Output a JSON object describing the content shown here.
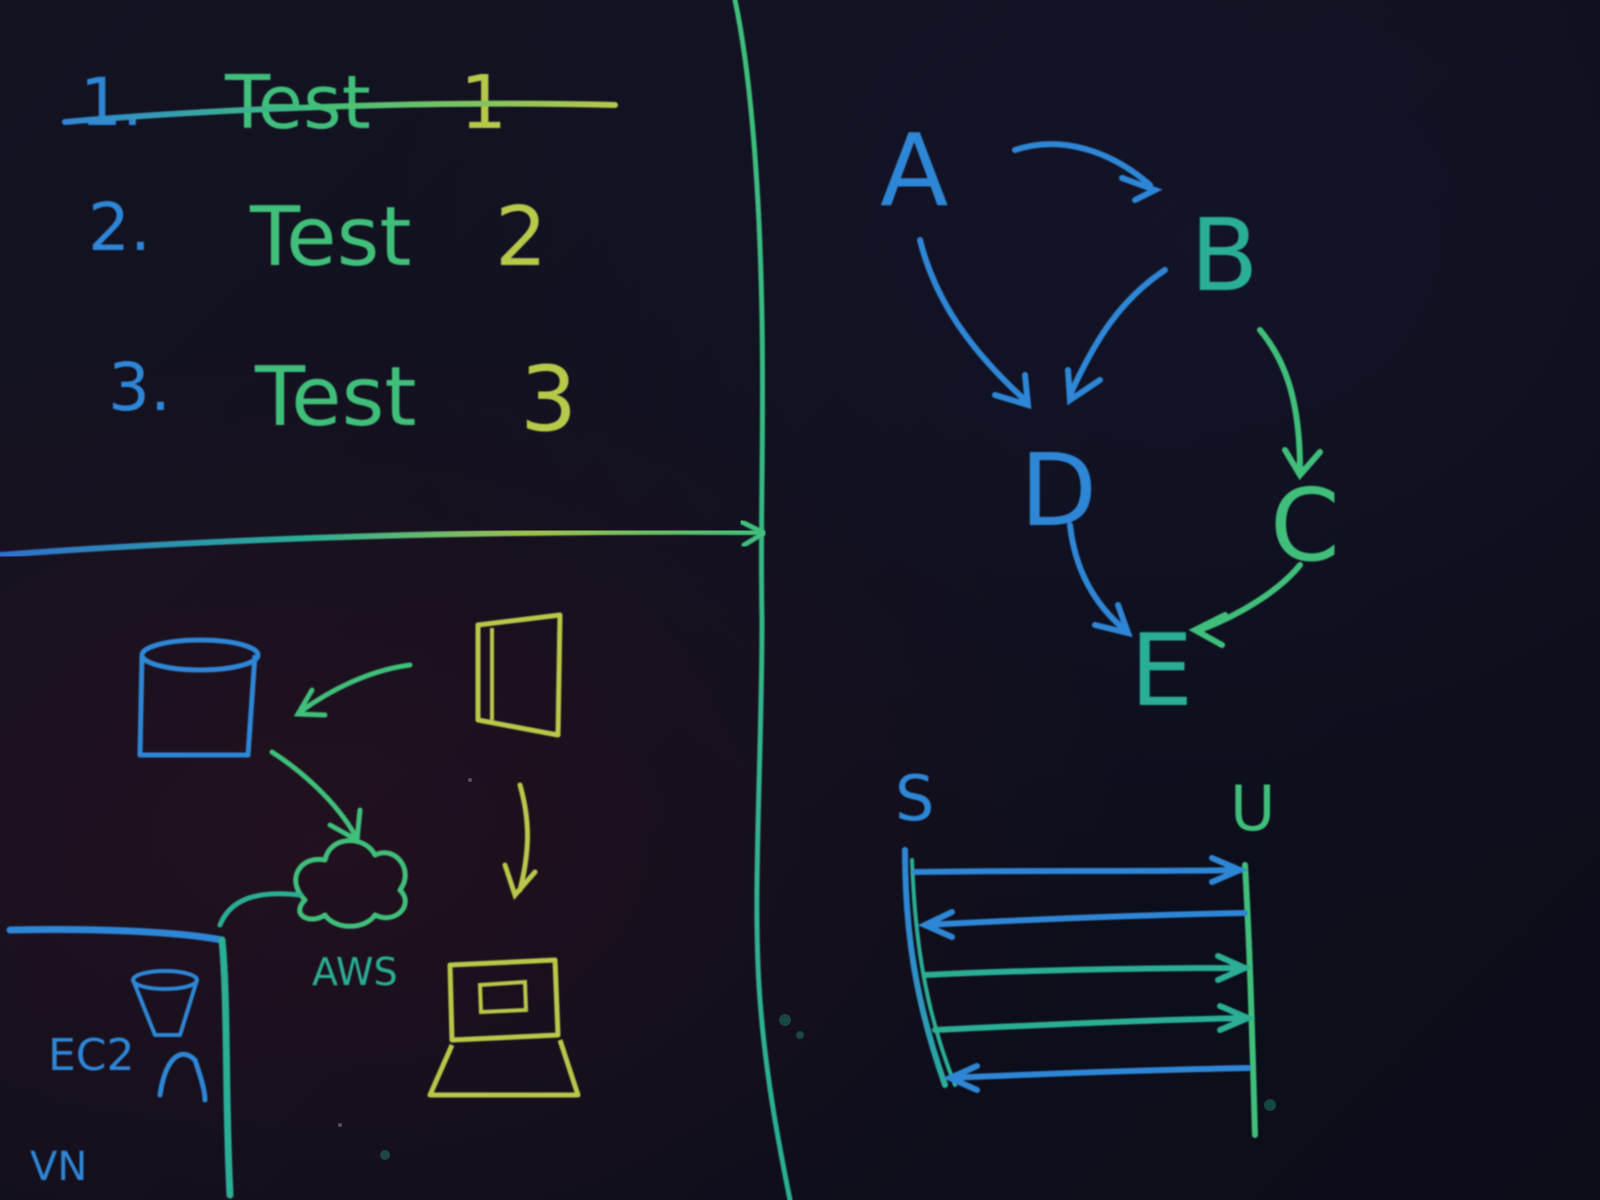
{
  "todo_list": {
    "items": [
      {
        "number": "1.",
        "text": "Test",
        "index": "1",
        "struck": true
      },
      {
        "number": "2.",
        "text": "Test",
        "index": "2",
        "struck": false
      },
      {
        "number": "3.",
        "text": "Test",
        "index": "3",
        "struck": false
      }
    ]
  },
  "graph": {
    "nodes": [
      "A",
      "B",
      "C",
      "D",
      "E"
    ],
    "edges": [
      [
        "A",
        "B"
      ],
      [
        "A",
        "D"
      ],
      [
        "B",
        "D"
      ],
      [
        "B",
        "C"
      ],
      [
        "C",
        "E"
      ],
      [
        "D",
        "E"
      ]
    ]
  },
  "architecture": {
    "aws_label": "AWS",
    "ec2_label": "EC2",
    "corner_label": "VN"
  },
  "sequence": {
    "left_label": "S",
    "right_label": "U",
    "messages": [
      "S→U",
      "U→S",
      "S→U",
      "S→U",
      "U→S"
    ]
  },
  "colors": {
    "board": "#0f1020",
    "chalk_blue": "#2f86d6",
    "chalk_teal": "#2aae95",
    "chalk_green": "#3fbf7a",
    "chalk_yellow": "#b8c84a"
  }
}
